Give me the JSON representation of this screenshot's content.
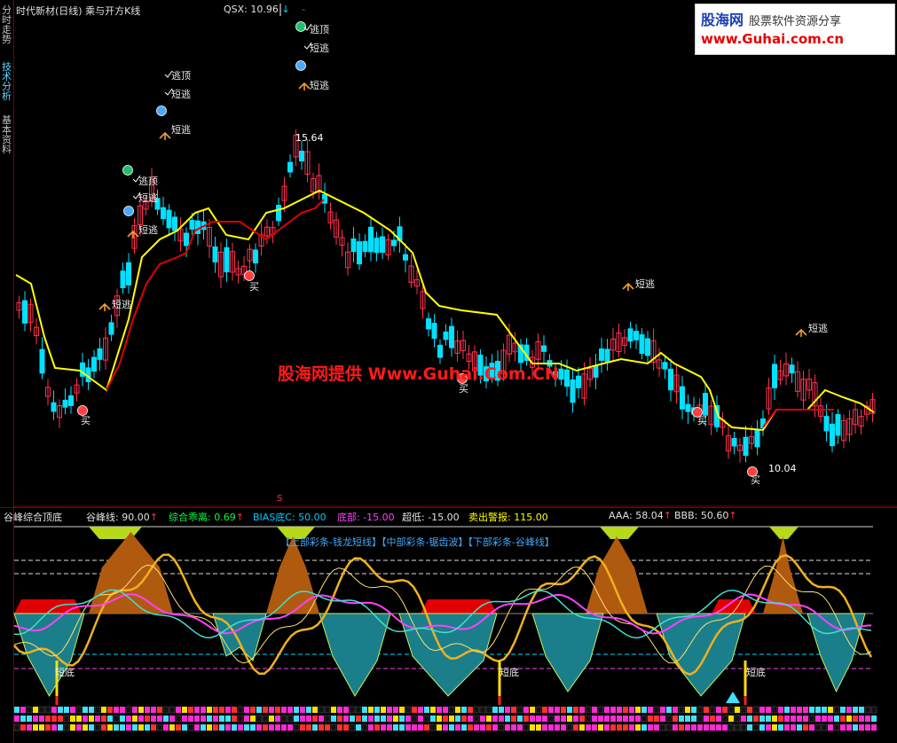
{
  "sidebar": {
    "tabs": [
      "分时走势",
      "技术分析",
      "基本资料"
    ],
    "active": 1
  },
  "header": {
    "title": "时代新材(日线) 乘与开方K线",
    "qsx_label": "QSX: 10.96",
    "qsx_arrow": "↓",
    "qsx_arrow2": "-"
  },
  "ad": {
    "line1": "股海网",
    "line1_tag": "股票软件资源分享",
    "line2": "www.Guhai.com.cn"
  },
  "watermark": "股海网提供 Www.Guhai.Com.CN",
  "price_chart": {
    "high_label": "15.64",
    "low_label": "10.04",
    "signals": [
      {
        "text": "逃顶"
      },
      {
        "text": "短逃"
      },
      {
        "text": "短逃"
      },
      {
        "text": "逃顶"
      },
      {
        "text": "短逃"
      },
      {
        "text": "短逃"
      },
      {
        "text": "逃顶"
      },
      {
        "text": "短逃"
      },
      {
        "text": "短逃"
      },
      {
        "text": "短逃"
      },
      {
        "text": "短逃"
      },
      {
        "text": "短逃"
      },
      {
        "text": "买"
      },
      {
        "text": "买"
      },
      {
        "text": "买"
      },
      {
        "text": "买"
      },
      {
        "text": "买"
      }
    ],
    "s_marker": "S",
    "candles_count": 150,
    "colors": {
      "up": "#ff3050",
      "down": "#00e0ff",
      "upper_line": "#ffff00",
      "lower_line": "#e00000"
    }
  },
  "indicator": {
    "name": "谷峰综合顶底",
    "items": [
      {
        "label": "谷峰线: 90.00",
        "arrow": "↑",
        "color": "#e0e0e0"
      },
      {
        "label": "综合乖离: 0.69",
        "arrow": "↑",
        "color": "#00ff40"
      },
      {
        "label": "BIAS底C: 50.00",
        "arrow": "",
        "color": "#00c8ff"
      },
      {
        "label": "底部: -15.00",
        "arrow": "",
        "color": "#ff40ff"
      },
      {
        "label": "超低: -15.00",
        "arrow": "",
        "color": "#e0e0e0"
      },
      {
        "label": "卖出警报: 115.00",
        "arrow": "",
        "color": "#ffff00"
      },
      {
        "label": "AAA: 58.04",
        "arrow": "↑",
        "color": "#e0e0e0"
      },
      {
        "label": "BBB: 50.60",
        "arrow": "↑",
        "color": "#e0e0e0"
      }
    ],
    "legend": "【上部彩条-钱龙短线】【中部彩条-锯齿波】【下部彩条-谷峰线】",
    "bottom_labels": [
      "短底",
      "短底",
      "短底"
    ]
  }
}
